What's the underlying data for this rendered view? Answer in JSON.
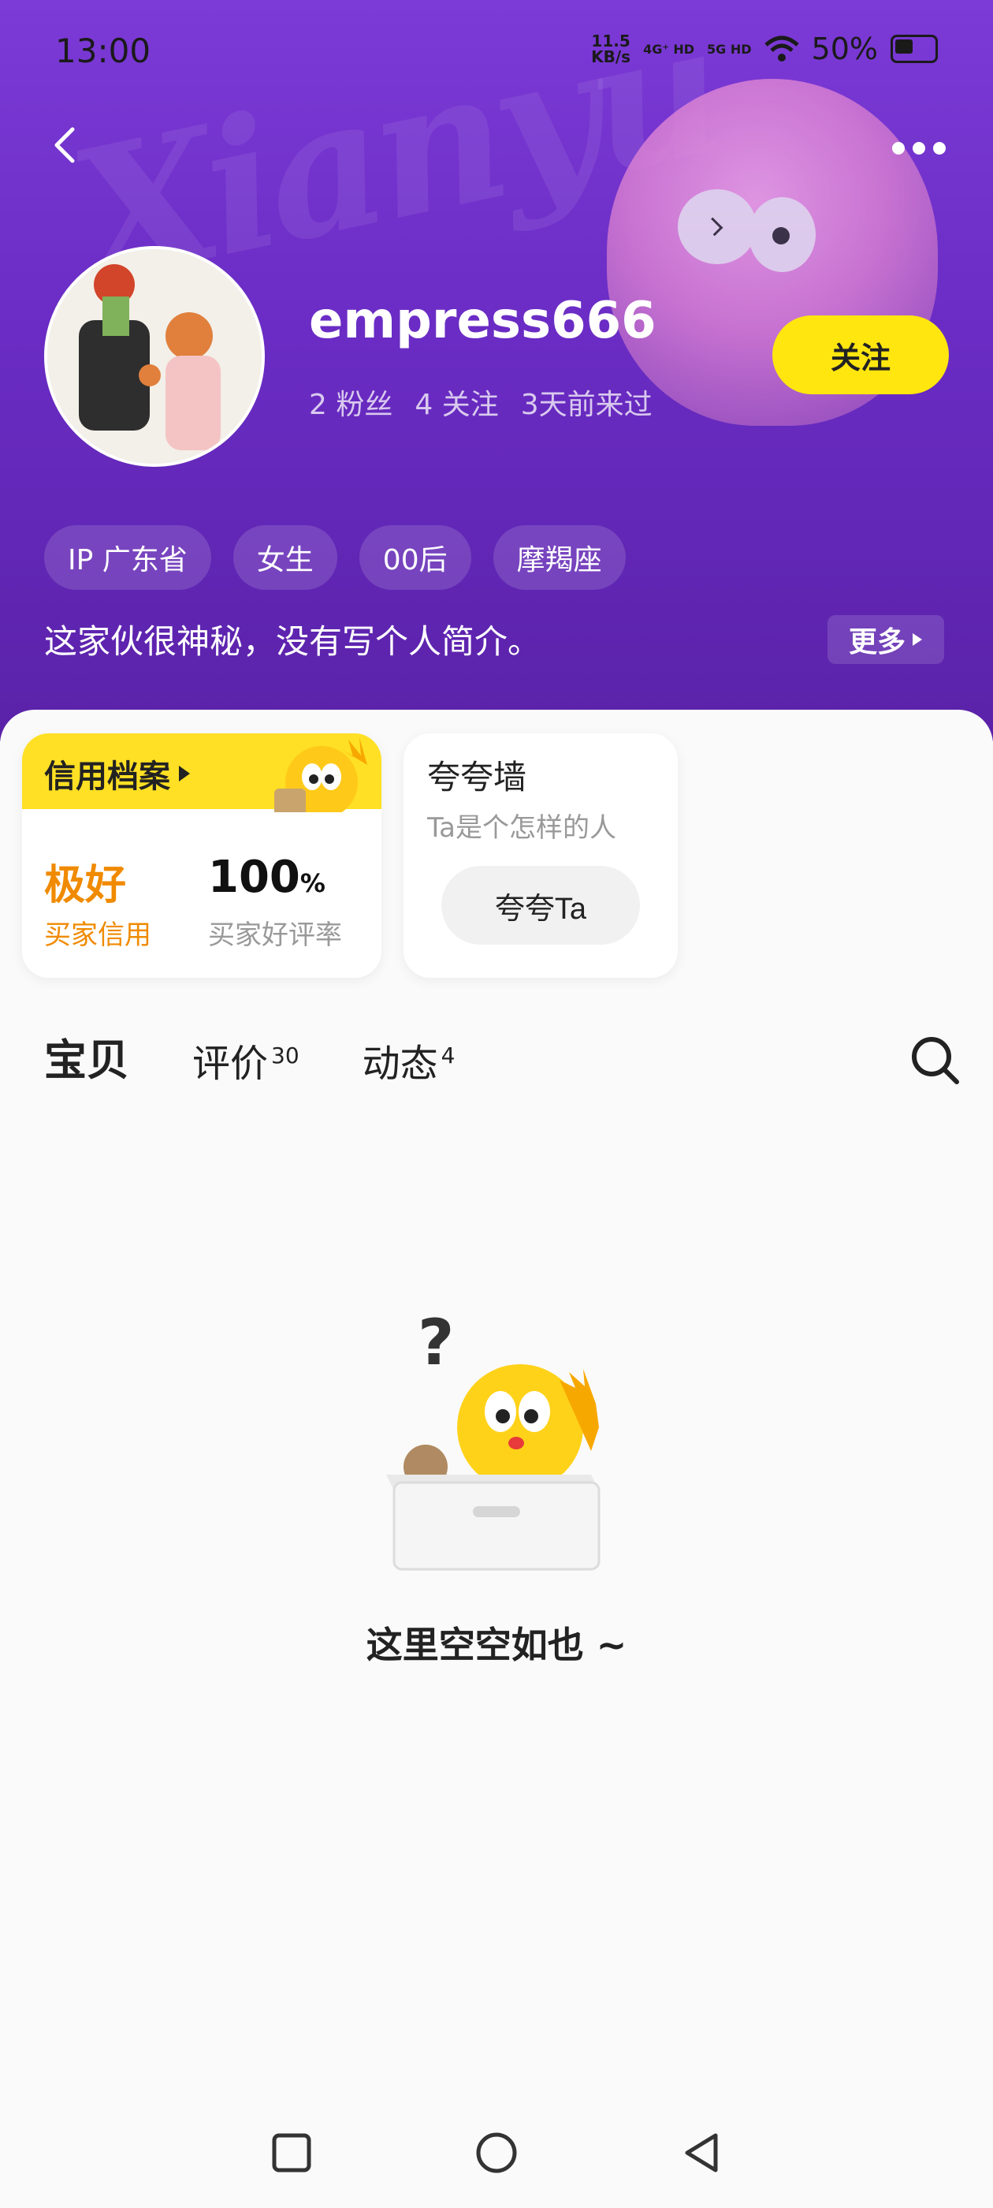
{
  "status_bar": {
    "time": "13:00",
    "speed_value": "11.5",
    "speed_unit": "KB/s",
    "net1": "4G⁺ HD",
    "net2": "5G HD",
    "battery": "50%"
  },
  "profile": {
    "username": "empress666",
    "fans": "2 粉丝",
    "following": "4 关注",
    "last_seen": "3天前来过",
    "follow_label": "关注",
    "tags": [
      "IP 广东省",
      "女生",
      "00后",
      "摩羯座"
    ],
    "bio": "这家伙很神秘，没有写个人简介。",
    "more_label": "更多"
  },
  "credit": {
    "title": "信用档案",
    "rating_value": "极好",
    "rating_label": "买家信用",
    "good_rate_value": "100",
    "good_rate_unit": "%",
    "good_rate_label": "买家好评率"
  },
  "praise": {
    "title": "夸夸墙",
    "subtitle": "Ta是个怎样的人",
    "button_label": "夸夸Ta"
  },
  "tabs": [
    {
      "label": "宝贝",
      "count": ""
    },
    {
      "label": "评价",
      "count": "30"
    },
    {
      "label": "动态",
      "count": "4"
    }
  ],
  "empty": {
    "text": "这里空空如也 ~"
  },
  "colors": {
    "hero_purple": "#6a2cc4",
    "accent_yellow": "#ffe024",
    "credit_orange": "#f08a00"
  }
}
